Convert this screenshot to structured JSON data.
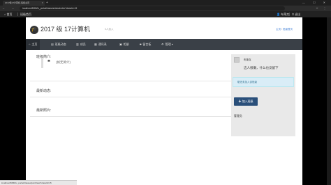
{
  "browser": {
    "tab_title": "2017级17计算机-班级主页",
    "url": "localhost:8080/tx_portal/classes/classIndex?classId=15",
    "new_tab_icon": "plus-icon",
    "window_controls": "— ☐ ✕",
    "nav_icons": "← → ⟳",
    "toolbar_icons": "☆ ⋮"
  },
  "topnav": {
    "home": "首页",
    "my_classes": "班级首页",
    "user": "布莱克",
    "logout": "退出"
  },
  "header": {
    "title": "2017 级 17计算机",
    "subtitle": "0人加入",
    "breadcrumb_home": "主页",
    "breadcrumb_sep": " / ",
    "breadcrumb_current": "班级首页"
  },
  "mainnav": {
    "items": [
      {
        "icon": "home-icon",
        "label": "主页"
      },
      {
        "icon": "news-icon",
        "label": "班级动态"
      },
      {
        "icon": "chart-icon",
        "label": "成员"
      },
      {
        "icon": "contacts-icon",
        "label": "通讯录"
      },
      {
        "icon": "photo-icon",
        "label": "相册"
      },
      {
        "icon": "message-icon",
        "label": "留言板"
      },
      {
        "icon": "gear-icon",
        "label": "管理"
      }
    ]
  },
  "main": {
    "intro_title": "班级简介:",
    "intro_text": "(如无简介)",
    "news_title": "最新动态:",
    "photos_title": "最新照片:"
  },
  "sidebar": {
    "name": "布莱克",
    "motto": "这人很懒，什么也没留下",
    "alert": "您还未加入该班级",
    "join_button": "加入班级",
    "admin_label": "管理员:"
  },
  "statusbar": {
    "text": "localhost:8080/tx_portal/classes/joinClass?classId=15"
  }
}
